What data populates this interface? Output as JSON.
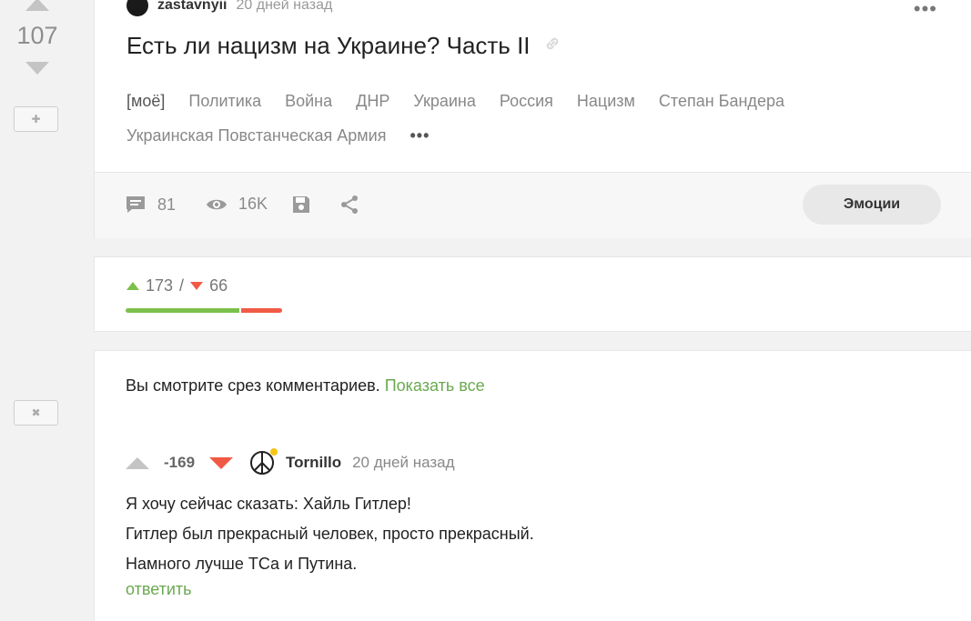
{
  "post": {
    "rating": "107",
    "author": "zastavnyii",
    "time": "20 дней назад",
    "title": "Есть ли нацизм на Украине? Часть II",
    "tags": [
      "[моё]",
      "Политика",
      "Война",
      "ДНР",
      "Украина",
      "Россия",
      "Нацизм",
      "Степан Бандера",
      "Украинская Повстанческая Армия"
    ],
    "tags_more": "•••",
    "comments_count": "81",
    "views_count": "16K",
    "emotions_label": "Эмоции"
  },
  "votes": {
    "pluses": "173",
    "separator": "/",
    "minuses": "66",
    "pluses_fraction": 0.724
  },
  "slice": {
    "text": "Вы смотрите срез комментариев.",
    "show_all": "Показать все"
  },
  "comment": {
    "rating": "-169",
    "author": "Tornillo",
    "time": "20 дней назад",
    "lines": [
      "Я хочу сейчас сказать: Хайль Гитлер!",
      "Гитлер был прекрасный человек, просто прекрасный.",
      "Намного лучше ТСа и Путина."
    ],
    "reply": "ответить"
  },
  "rail": {
    "plus_symbol": "✚",
    "close_symbol": "✖"
  },
  "colors": {
    "positive": "#7cc04b",
    "negative": "#f05a45",
    "link_green": "#6aa84f"
  },
  "icons": [
    "comment-icon",
    "eye-icon",
    "save-icon",
    "share-icon",
    "link-icon",
    "peace-icon"
  ]
}
